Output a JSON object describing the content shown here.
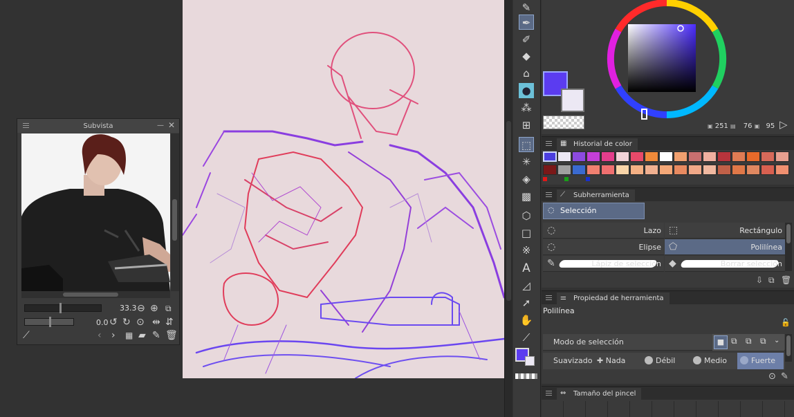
{
  "subvista": {
    "title": "Subvista",
    "zoom_value": "33.3",
    "rotation_value": "0.0"
  },
  "color": {
    "main": "#5b3cf0",
    "sub": "#ece8f4",
    "values": {
      "h": "251",
      "s": "76",
      "v": "95"
    }
  },
  "color_history": {
    "title": "Historial de color",
    "swatches": [
      "#4b3ee0",
      "#ece8f4",
      "#8c4ae0",
      "#c43fd8",
      "#e43e8c",
      "#f1d3d8",
      "#e84a6a",
      "#f08a3a",
      "#ffffff",
      "#f0a070",
      "#c87070",
      "#f0b0a0",
      "#b8343c",
      "#e07c54",
      "#e86a2a",
      "#d86a5a",
      "#e8a090",
      "#7a1818",
      "#a0a0a0",
      "#3a6ad0",
      "#f08070",
      "#f07070",
      "#f8d4a8",
      "#f4b084",
      "#f0b090",
      "#f4a878",
      "#e88a60",
      "#f0a888",
      "#f0b8a0",
      "#c06048",
      "#e07848",
      "#e08860",
      "#d86050",
      "#f09070"
    ]
  },
  "subtool": {
    "title": "Subherramienta",
    "group": "Selección",
    "items": [
      {
        "label": "Lazo",
        "icon": "lasso-icon"
      },
      {
        "label": "Rectángulo",
        "icon": "rectangle-select-icon"
      },
      {
        "label": "Elipse",
        "icon": "ellipse-select-icon"
      },
      {
        "label": "Polilínea",
        "icon": "polyline-select-icon"
      },
      {
        "label": "Lápiz de selección",
        "icon": "selection-pen-icon"
      },
      {
        "label": "Borrar selección",
        "icon": "erase-selection-icon"
      }
    ]
  },
  "tool_property": {
    "title": "Propiedad de herramienta",
    "tool_name": "Polilínea",
    "selection_mode_label": "Modo de selección",
    "smoothing_label": "Suavizado",
    "smoothing_options": [
      "Nada",
      "Débil",
      "Medio",
      "Fuerte"
    ]
  },
  "brush_size": {
    "title": "Tamaño del pincel"
  }
}
